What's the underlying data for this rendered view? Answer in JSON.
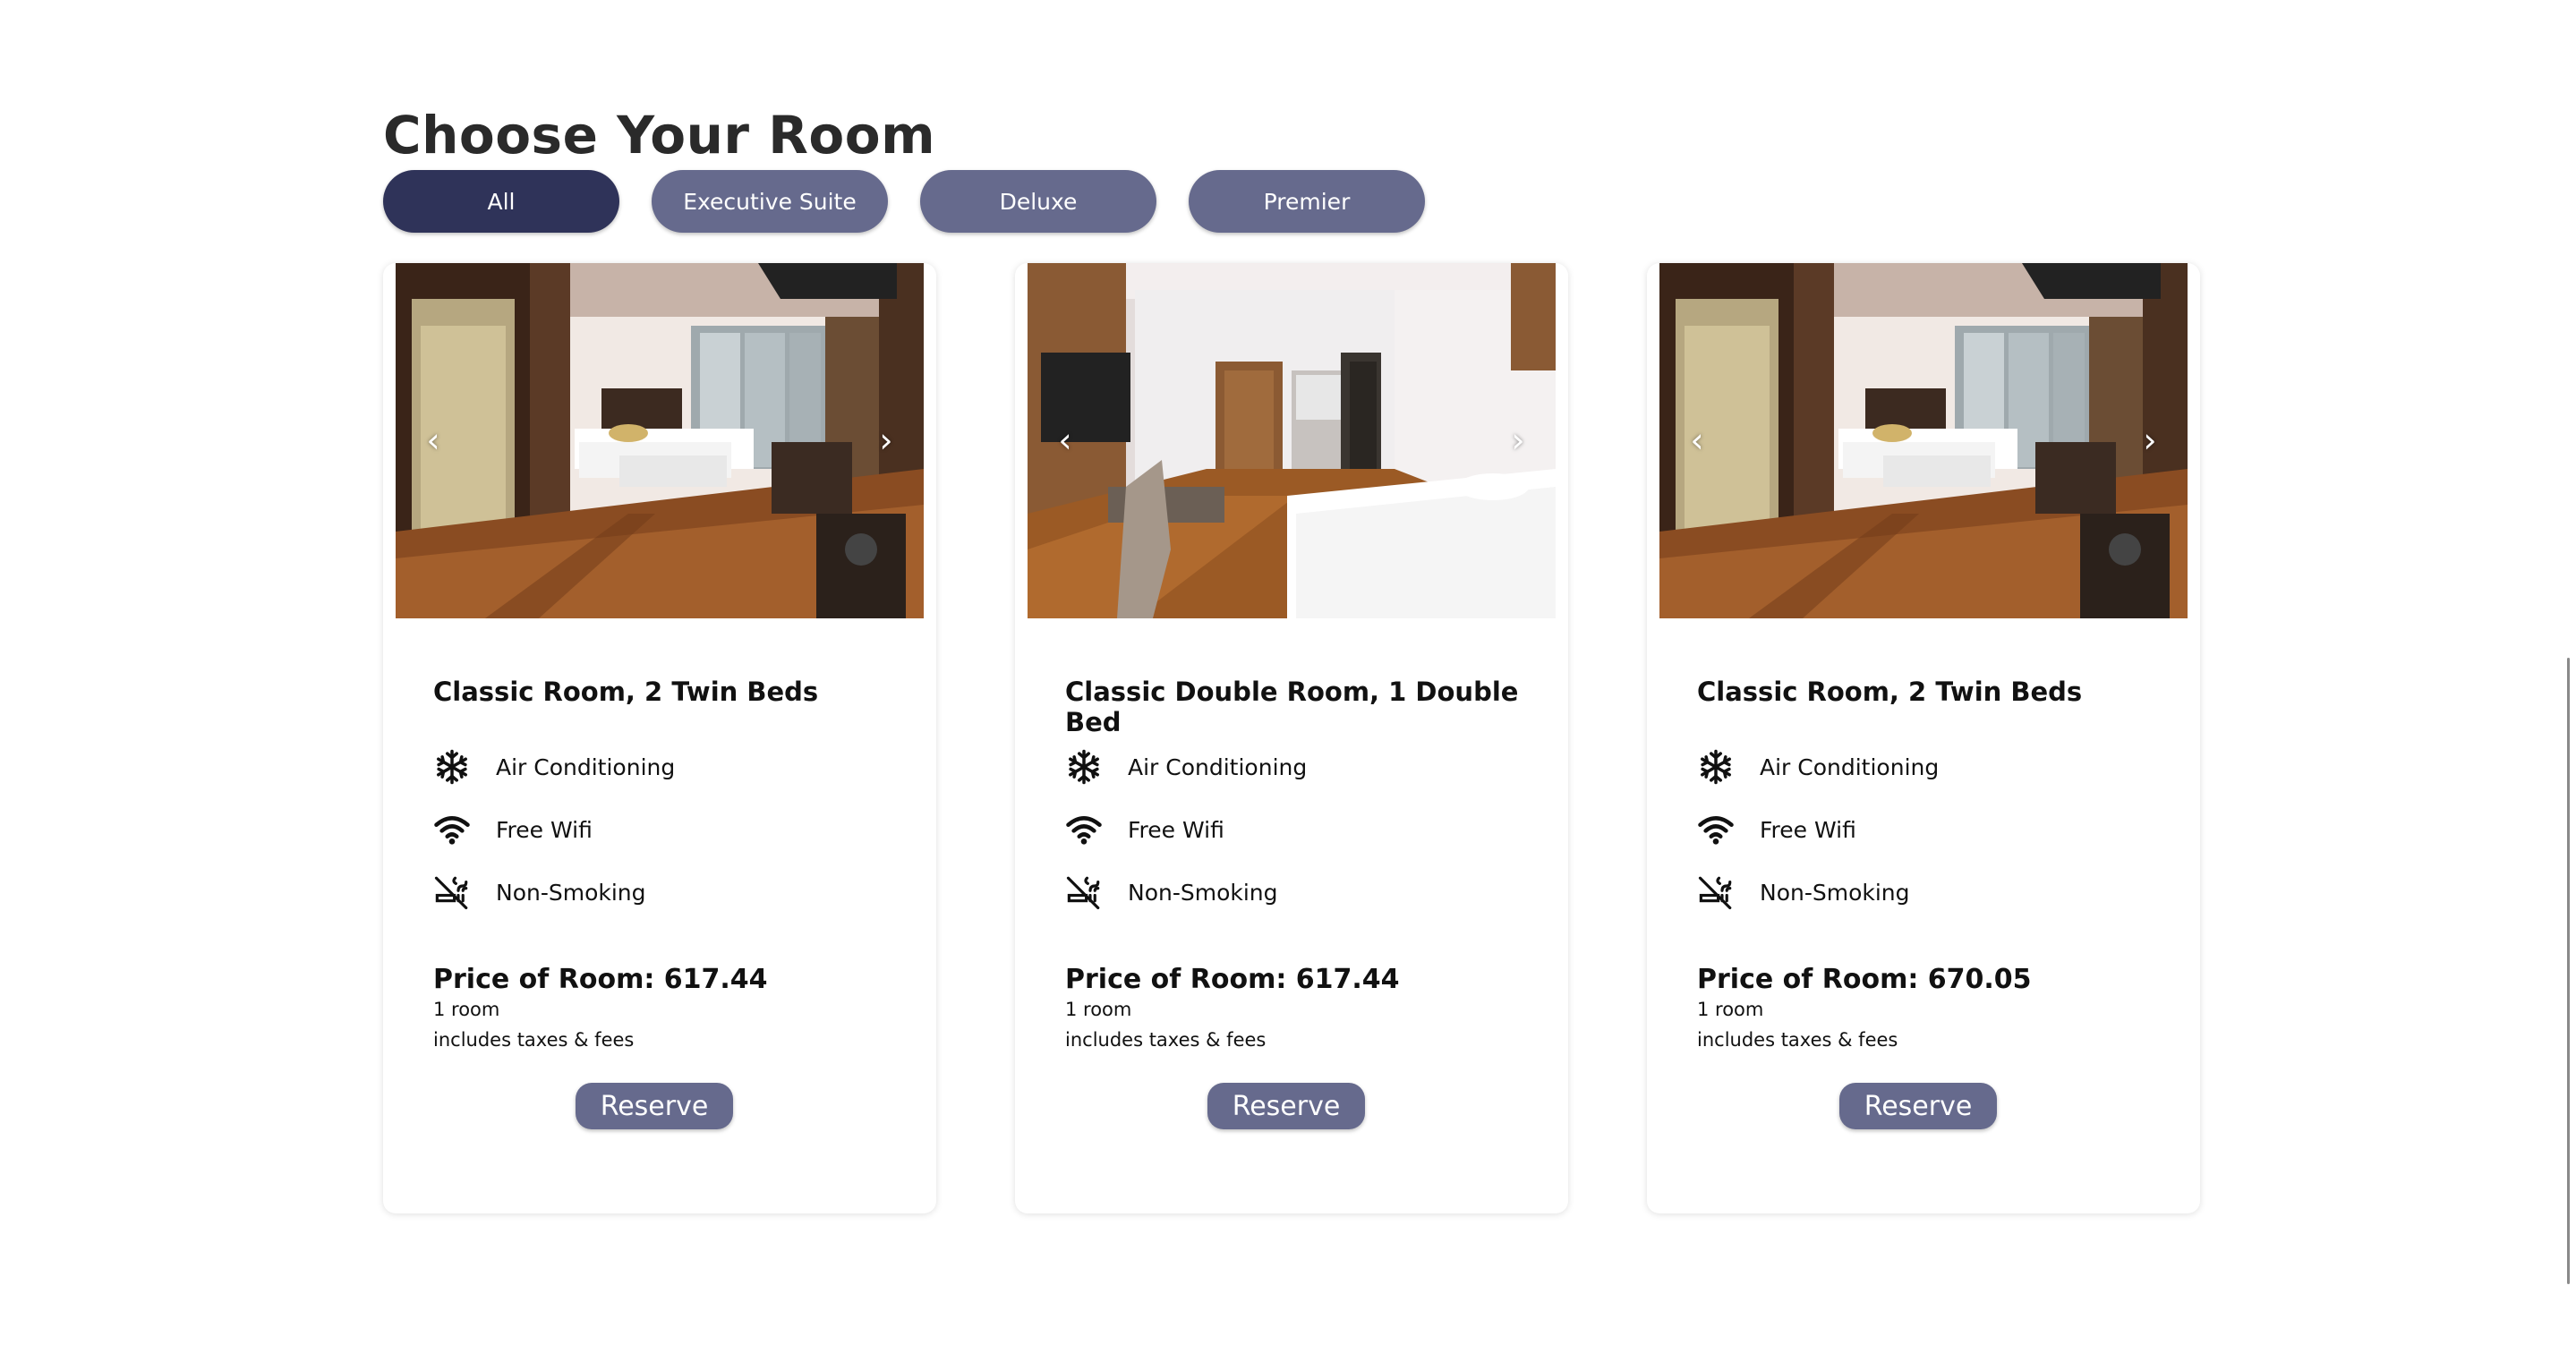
{
  "section": {
    "title": "Choose Your Room"
  },
  "filters": [
    {
      "label": "All",
      "active": true
    },
    {
      "label": "Executive Suite",
      "active": false
    },
    {
      "label": "Deluxe",
      "active": false
    },
    {
      "label": "Premier",
      "active": false
    }
  ],
  "cards": [
    {
      "name": "Classic Room, 2 Twin Beds",
      "amenities": [
        {
          "icon": "snowflake-icon",
          "label": "Air Conditioning"
        },
        {
          "icon": "wifi-icon",
          "label": "Free Wifi"
        },
        {
          "icon": "no-smoking-icon",
          "label": "Non-Smoking"
        }
      ],
      "price": "Price of Room: 617.44",
      "rooms": "1 room",
      "taxes": "includes taxes & fees",
      "reserve_label": "Reserve"
    },
    {
      "name": "Classic Double Room, 1 Double Bed",
      "amenities": [
        {
          "icon": "snowflake-icon",
          "label": "Air Conditioning"
        },
        {
          "icon": "wifi-icon",
          "label": "Free Wifi"
        },
        {
          "icon": "no-smoking-icon",
          "label": "Non-Smoking"
        }
      ],
      "price": "Price of Room: 617.44",
      "rooms": "1 room",
      "taxes": "includes taxes & fees",
      "reserve_label": "Reserve"
    },
    {
      "name": "Classic Room, 2 Twin Beds",
      "amenities": [
        {
          "icon": "snowflake-icon",
          "label": "Air Conditioning"
        },
        {
          "icon": "wifi-icon",
          "label": "Free Wifi"
        },
        {
          "icon": "no-smoking-icon",
          "label": "Non-Smoking"
        }
      ],
      "price": "Price of Room: 670.05",
      "rooms": "1 room",
      "taxes": "includes taxes & fees",
      "reserve_label": "Reserve"
    }
  ],
  "carousel": {
    "prev_glyph": "‹",
    "next_glyph": "›"
  },
  "colors": {
    "primary": "#666a8d",
    "primary_active": "#2f3359"
  }
}
